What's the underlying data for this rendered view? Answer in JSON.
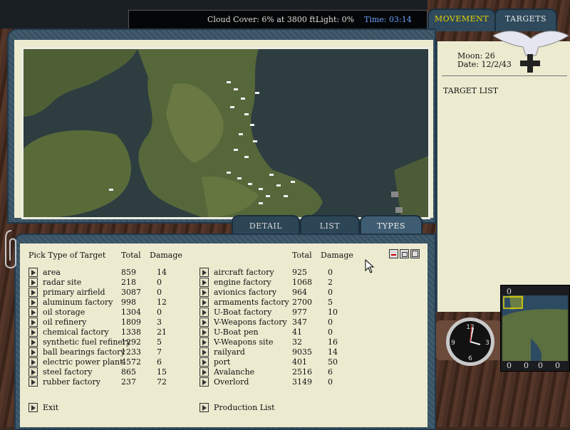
{
  "status_bar": {
    "cloud_cover": "Cloud Cover:  6% at 3800 ft.",
    "light": "Light:  0%",
    "time": "Time: 03:14",
    "time_color": "#6fa0ff"
  },
  "top_tabs": {
    "movement": "MOVEMENT",
    "targets": "TARGETS",
    "active_color": "#e7d400",
    "inactive_color": "#e8e8e8"
  },
  "info": {
    "moon": "Moon:  26",
    "date": "Date:  12/2/43",
    "target_list": "TARGET LIST"
  },
  "sub_tabs": {
    "detail": "DETAIL",
    "list": "LIST",
    "types": "TYPES"
  },
  "table": {
    "pick_header": "Pick Type of Target",
    "total_header": "Total",
    "damage_header": "Damage",
    "left": [
      {
        "name": "area",
        "total": "859",
        "damage": "14"
      },
      {
        "name": "radar site",
        "total": "218",
        "damage": "0"
      },
      {
        "name": "primary airfield",
        "total": "3087",
        "damage": "0"
      },
      {
        "name": "aluminum factory",
        "total": "998",
        "damage": "12"
      },
      {
        "name": "oil storage",
        "total": "1304",
        "damage": "0"
      },
      {
        "name": "oil refinery",
        "total": "1809",
        "damage": "3"
      },
      {
        "name": "chemical factory",
        "total": "1338",
        "damage": "21"
      },
      {
        "name": "synthetic fuel refinery",
        "total": "1292",
        "damage": "5"
      },
      {
        "name": "ball bearings factory",
        "total": "1233",
        "damage": "7"
      },
      {
        "name": "electric power plant",
        "total": "4572",
        "damage": "6"
      },
      {
        "name": "steel factory",
        "total": "865",
        "damage": "15"
      },
      {
        "name": "rubber factory",
        "total": "237",
        "damage": "72"
      }
    ],
    "right": [
      {
        "name": "aircraft factory",
        "total": "925",
        "damage": "0"
      },
      {
        "name": "engine factory",
        "total": "1068",
        "damage": "2"
      },
      {
        "name": "avionics factory",
        "total": "964",
        "damage": "0"
      },
      {
        "name": "armaments factory",
        "total": "2700",
        "damage": "5"
      },
      {
        "name": "U-Boat factory",
        "total": "977",
        "damage": "10"
      },
      {
        "name": "V-Weapons factory",
        "total": "347",
        "damage": "0"
      },
      {
        "name": "U-Boat pen",
        "total": "41",
        "damage": "0"
      },
      {
        "name": "V-Weapons site",
        "total": "32",
        "damage": "16"
      },
      {
        "name": "railyard",
        "total": "9035",
        "damage": "14"
      },
      {
        "name": "port",
        "total": "401",
        "damage": "50"
      },
      {
        "name": "Avalanche",
        "total": "2516",
        "damage": "6"
      },
      {
        "name": "Overlord",
        "total": "3149",
        "damage": "0"
      }
    ]
  },
  "actions": {
    "exit": "Exit",
    "production_list": "Production List"
  },
  "minimap": {
    "top": "0",
    "bottom_left": "0",
    "bottom_mid1": "0",
    "bottom_mid2": "0",
    "bottom_right": "0"
  },
  "icons": {
    "emblem": "luftwaffe-eagle-icon",
    "cross": "balkenkreuz-icon",
    "clock": "cockpit-clock-icon",
    "cursor": "mouse-pointer-icon"
  }
}
